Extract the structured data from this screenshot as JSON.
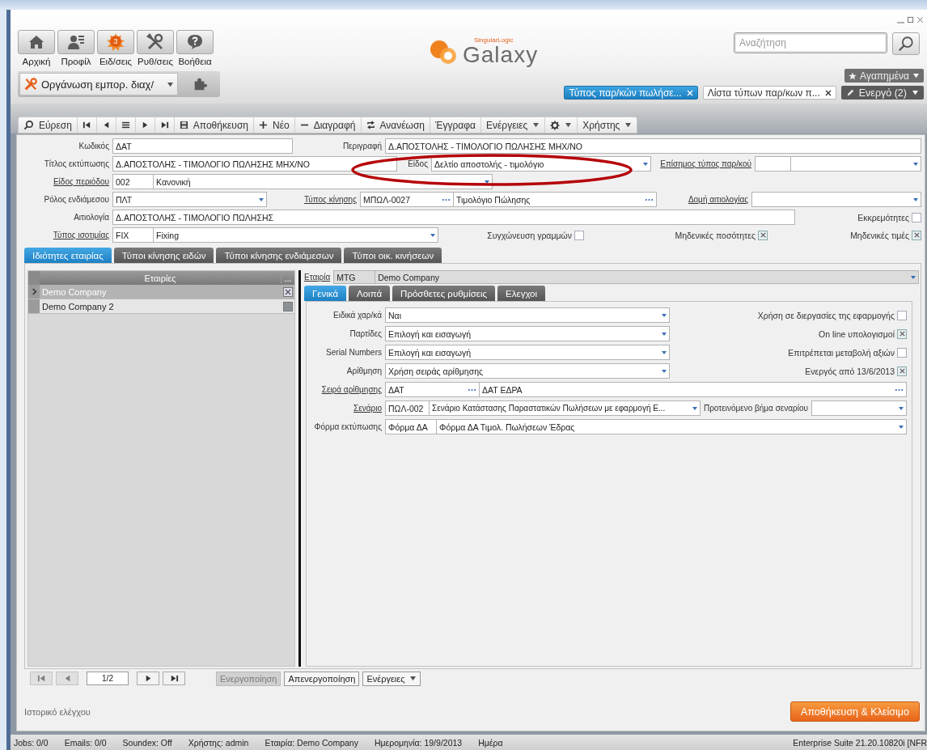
{
  "nav": [
    {
      "kind": "home",
      "label": "Αρχική"
    },
    {
      "kind": "profile",
      "label": "Προφίλ"
    },
    {
      "kind": "alerts",
      "label": "Ειδ/σεις",
      "badge": "3"
    },
    {
      "kind": "tools",
      "label": "Ρυθ/σεις"
    },
    {
      "kind": "help",
      "label": "Βοήθεια"
    }
  ],
  "module_selector": {
    "label": "Οργάνωση εμπορ. διαχ/"
  },
  "logo": {
    "brand": "SingularLogic",
    "name": "Galaxy"
  },
  "search": {
    "placeholder": "Αναζήτηση"
  },
  "favorites": {
    "label": "Αγαπημένα"
  },
  "doc_tabs": [
    {
      "label": "Τύπος παρ/κών πωλήσε...",
      "selected": true
    },
    {
      "label": "Λίστα τύπων παρ/κων π...",
      "selected": false
    }
  ],
  "active_windows": {
    "label": "Ενεργό (2)"
  },
  "toolbar": [
    {
      "kind": "search",
      "label": "Εύρεση"
    },
    {
      "kind": "first"
    },
    {
      "kind": "prev"
    },
    {
      "kind": "list"
    },
    {
      "kind": "next"
    },
    {
      "kind": "last"
    },
    {
      "kind": "save",
      "label": "Αποθήκευση"
    },
    {
      "kind": "plus",
      "label": "Νέο"
    },
    {
      "kind": "minus",
      "label": "Διαγραφή"
    },
    {
      "kind": "refresh",
      "label": "Ανανέωση"
    },
    {
      "kind": "text",
      "label": "Έγγραφα"
    },
    {
      "kind": "text",
      "label": "Ενέργειες",
      "menu": true
    },
    {
      "kind": "gear",
      "menu": true
    },
    {
      "kind": "text",
      "label": "Χρήστης",
      "menu": true
    }
  ],
  "form": {
    "lines": [
      {
        "items": [
          {
            "kind": "label",
            "text": "Κωδικός"
          },
          {
            "kind": "text",
            "value": "ΔΑΤ"
          },
          {
            "kind": "label",
            "text": "Περιγραφή"
          },
          {
            "kind": "text",
            "value": "Δ.ΑΠΟΣΤΟΛΗΣ - ΤΙΜΟΛΟΓΙΟ ΠΩΛΗΣΗΣ ΜΗΧ/ΝΟ"
          }
        ]
      },
      {
        "items": [
          {
            "kind": "label",
            "text": "Τίτλος εκτύπωσης"
          },
          {
            "kind": "text",
            "value": "Δ.ΑΠΟΣΤΟΛΗΣ - ΤΙΜΟΛΟΓΙΟ ΠΩΛΗΣΗΣ ΜΗΧ/ΝΟ"
          },
          {
            "kind": "label",
            "text": "Είδος"
          },
          {
            "kind": "combo",
            "value": "Δελτίο αποστολής - τιμολόγιο"
          },
          {
            "kind": "label",
            "text": "Επίσημος τύπος παρ/κού",
            "link": true
          },
          {
            "kind": "text"
          },
          {
            "kind": "combo"
          }
        ]
      },
      {
        "items": [
          {
            "kind": "label",
            "text": "Είδος περιόδου",
            "link": true
          },
          {
            "kind": "text",
            "value": "002"
          },
          {
            "kind": "combo",
            "value": "Κανονική"
          }
        ]
      },
      {
        "items": [
          {
            "kind": "label",
            "text": "Ρόλος ενδιάμεσου"
          },
          {
            "kind": "combo",
            "value": "ΠΛΤ"
          },
          {
            "kind": "label",
            "text": "Τύπος κίνησης",
            "link": true
          },
          {
            "kind": "lookup",
            "value": "ΜΠΩΛ-0027"
          },
          {
            "kind": "lookup",
            "value": "Τιμολόγιο Πώλησης"
          },
          {
            "kind": "label",
            "text": "Δομή αιτιολογίας",
            "link": true
          },
          {
            "kind": "combo"
          }
        ]
      },
      {
        "items": [
          {
            "kind": "label",
            "text": "Αιτιολογία"
          },
          {
            "kind": "text",
            "value": "Δ.ΑΠΟΣΤΟΛΗΣ - ΤΙΜΟΛΟΓΙΟ ΠΩΛΗΣΗΣ"
          },
          {
            "kind": "check",
            "label": "Εκκρεμότητες",
            "checked": false
          }
        ]
      },
      {
        "items": [
          {
            "kind": "label",
            "text": "Τύπος ισοτιμίας",
            "link": true
          },
          {
            "kind": "text",
            "value": "FIX"
          },
          {
            "kind": "combo",
            "value": "Fixing"
          },
          {
            "kind": "check",
            "label": "Συγχώνευση γραμμών",
            "checked": false
          },
          {
            "kind": "check",
            "label": "Μηδενικές ποσότητες",
            "checked": true
          },
          {
            "kind": "check",
            "label": "Μηδενικές τιμές",
            "checked": true
          }
        ]
      }
    ]
  },
  "annotation": {
    "kind": "ellipse"
  },
  "tabs": [
    {
      "label": "Ιδιότητες εταιρίας",
      "selected": true
    },
    {
      "label": "Τύποι κίνησης ειδών",
      "selected": false
    },
    {
      "label": "Τύποι κίνησης ενδιάμεσων",
      "selected": false
    },
    {
      "label": "Τύποι οικ. κινήσεων",
      "selected": false
    }
  ],
  "companies": {
    "columns": [
      "Εταιρίες",
      "..."
    ],
    "rows": [
      {
        "name": "Demo Company",
        "checked": true,
        "selected": true
      },
      {
        "name": "Demo Company 2",
        "checked": false,
        "selected": false
      }
    ]
  },
  "detail": {
    "header": {
      "items": [
        {
          "kind": "label",
          "text": "Εταιρία",
          "link": true
        },
        {
          "kind": "text",
          "value": "MTG",
          "disabled": true
        },
        {
          "kind": "combo",
          "value": "Demo Company",
          "disabled": true
        }
      ]
    },
    "tabs": [
      {
        "label": "Γενικά",
        "selected": true
      },
      {
        "label": "Λοιπά",
        "selected": false
      },
      {
        "label": "Πρόσθετες ρυθμίσεις",
        "selected": false
      },
      {
        "label": "Ελεγχοι",
        "selected": false
      }
    ],
    "lines": [
      {
        "items": [
          {
            "kind": "label",
            "text": "Ειδικά χαρ/κά"
          },
          {
            "kind": "combo",
            "value": "Ναι"
          },
          {
            "kind": "check",
            "label": "Χρήση σε διεργασίες της εφαρμογής",
            "checked": false
          }
        ]
      },
      {
        "items": [
          {
            "kind": "label",
            "text": "Παρτίδες"
          },
          {
            "kind": "combo",
            "value": "Επιλογή και εισαγωγή"
          },
          {
            "kind": "check",
            "label": "On line υπολογισμοί",
            "checked": true
          }
        ]
      },
      {
        "items": [
          {
            "kind": "label",
            "text": "Serial Numbers"
          },
          {
            "kind": "combo",
            "value": "Επιλογή και εισαγωγή"
          },
          {
            "kind": "check",
            "label": "Επιτρέπεται μεταβολή αξιών",
            "checked": false
          }
        ]
      },
      {
        "items": [
          {
            "kind": "label",
            "text": "Αρίθμηση"
          },
          {
            "kind": "combo",
            "value": "Χρήση σειράς αρίθμησης"
          },
          {
            "kind": "check",
            "label": "Ενεργός από 13/6/2013",
            "checked": true
          }
        ]
      },
      {
        "items": [
          {
            "kind": "label",
            "text": "Σειρά αρίθμησης",
            "link": true
          },
          {
            "kind": "lookup",
            "value": "ΔΑΤ"
          },
          {
            "kind": "lookup",
            "value": "ΔΑΤ ΕΔΡΑ"
          }
        ]
      },
      {
        "items": [
          {
            "kind": "label",
            "text": "Σενάριο",
            "link": true
          },
          {
            "kind": "text",
            "value": "ΠΩΛ-002"
          },
          {
            "kind": "combo",
            "value": "Σενάριο Κατάστασης Παραστατικών Πωλήσεων με εφαρμογή Ε..."
          },
          {
            "kind": "label",
            "text": "Προτεινόμενο βήμα σεναρίου"
          },
          {
            "kind": "combo"
          }
        ]
      },
      {
        "items": [
          {
            "kind": "label",
            "text": "Φόρμα εκτύπωσης"
          },
          {
            "kind": "text",
            "value": "Φόρμα ΔΑ"
          },
          {
            "kind": "combo",
            "value": "Φόρμα ΔΑ Τιμολ. Πωλήσεων Έδρας"
          }
        ]
      }
    ]
  },
  "pager": [
    {
      "kind": "first",
      "disabled": true
    },
    {
      "kind": "prev",
      "disabled": true
    },
    {
      "kind": "page",
      "value": "1/2"
    },
    {
      "kind": "next",
      "disabled": false
    },
    {
      "kind": "last",
      "disabled": false
    }
  ],
  "actions": [
    {
      "kind": "button",
      "label": "Ενεργοποίηση",
      "disabled": true
    },
    {
      "kind": "button",
      "label": "Απενεργοποίηση",
      "disabled": false
    },
    {
      "kind": "menu",
      "label": "Ενέργειες",
      "disabled": false
    }
  ],
  "audit_link": "Ιστορικό ελέγχου",
  "save_close": "Αποθήκευση & Κλείσιμο",
  "status_bar": {
    "items": [
      "Jobs: 0/0",
      "Emails: 0/0",
      "Soundex: Off",
      "Χρήστης: admin",
      "Εταιρία: Demo Company",
      "Ημερομηνία: 19/9/2013",
      "Ημέρα"
    ],
    "right": "Enterprise Suite  21.20.10820i [NFR"
  }
}
